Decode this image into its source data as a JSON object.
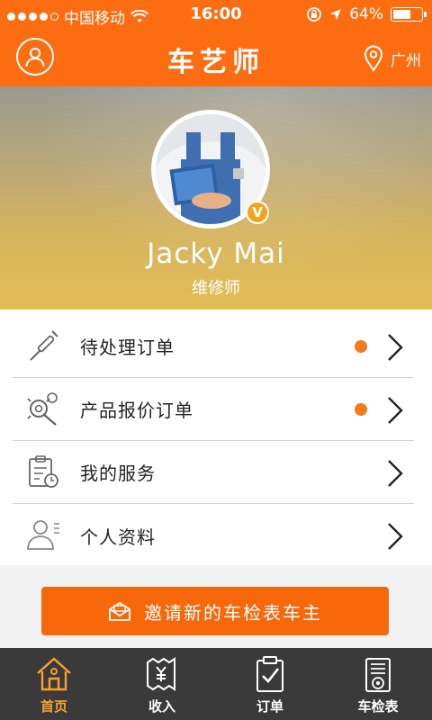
{
  "status_bar": {
    "carrier": "中国移动",
    "time": "16:00",
    "battery": "64%",
    "battery_level": 0.64
  },
  "header": {
    "title": "车艺师",
    "location": "广州"
  },
  "profile": {
    "name": "Jacky Mai",
    "role": "维修师",
    "badge": "V"
  },
  "menu": {
    "items": [
      {
        "label": "待处理订单",
        "icon": "screwdriver-icon",
        "has_dot": true
      },
      {
        "label": "产品报价订单",
        "icon": "gear-wrench-icon",
        "has_dot": true
      },
      {
        "label": "我的服务",
        "icon": "clipboard-clock-icon",
        "has_dot": false
      },
      {
        "label": "个人资料",
        "icon": "person-icon",
        "has_dot": false
      }
    ]
  },
  "invite_button": {
    "label": "邀请新的车检表车主"
  },
  "tabbar": {
    "tabs": [
      {
        "label": "首页",
        "icon": "home-icon",
        "active": true
      },
      {
        "label": "收入",
        "icon": "income-ticket-icon",
        "active": false
      },
      {
        "label": "订单",
        "icon": "order-clipboard-icon",
        "active": false
      },
      {
        "label": "车检表",
        "icon": "inspection-list-icon",
        "active": false
      }
    ]
  },
  "colors": {
    "brand_orange": "#fb6d10",
    "dot_orange": "#f37a1d",
    "tab_active": "#f7a12d",
    "tabbar_bg": "#3a3a3a"
  }
}
